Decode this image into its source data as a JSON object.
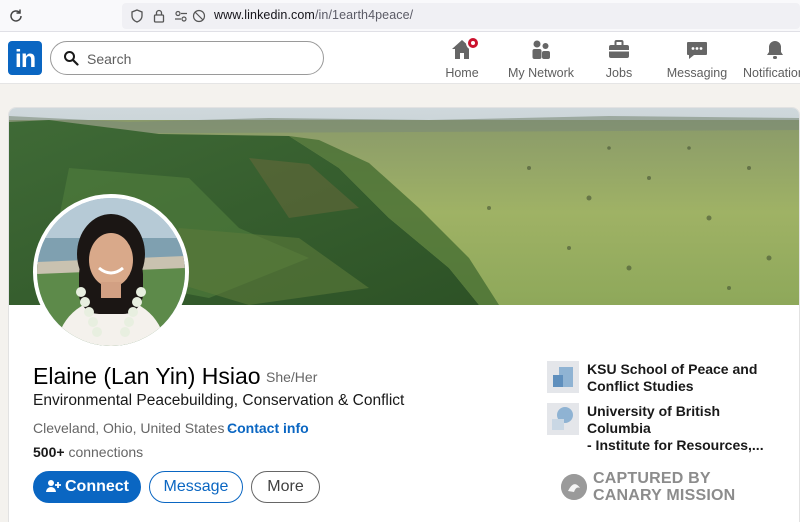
{
  "browser": {
    "url_domain": "www.linkedin.com",
    "url_path": "/in/1earth4peace/"
  },
  "nav": {
    "logo": "in",
    "search_placeholder": "Search",
    "items": [
      {
        "label": "Home",
        "icon": "home-icon"
      },
      {
        "label": "My Network",
        "icon": "network-icon"
      },
      {
        "label": "Jobs",
        "icon": "briefcase-icon"
      },
      {
        "label": "Messaging",
        "icon": "chat-icon"
      },
      {
        "label": "Notifications",
        "icon": "bell-icon"
      }
    ]
  },
  "profile": {
    "name": "Elaine (Lan Yin) Hsiao",
    "pronouns": "She/Her",
    "headline": "Environmental Peacebuilding, Conservation & Conflict",
    "location": "Cleveland, Ohio, United States ·",
    "contact_label": "Contact info",
    "connections_count": "500+",
    "connections_label": "connections",
    "buttons": {
      "connect": "Connect",
      "message": "Message",
      "more": "More"
    },
    "education": [
      {
        "line1": "KSU School of Peace and",
        "line2": "Conflict Studies"
      },
      {
        "line1": "University of British Columbia",
        "line2": "- Institute for Resources,..."
      }
    ]
  },
  "watermark": {
    "line1": "CAPTURED BY",
    "line2": "CANARY MISSION"
  },
  "colors": {
    "brand": "#0a66c2",
    "notification_badge": "#cb112d"
  }
}
